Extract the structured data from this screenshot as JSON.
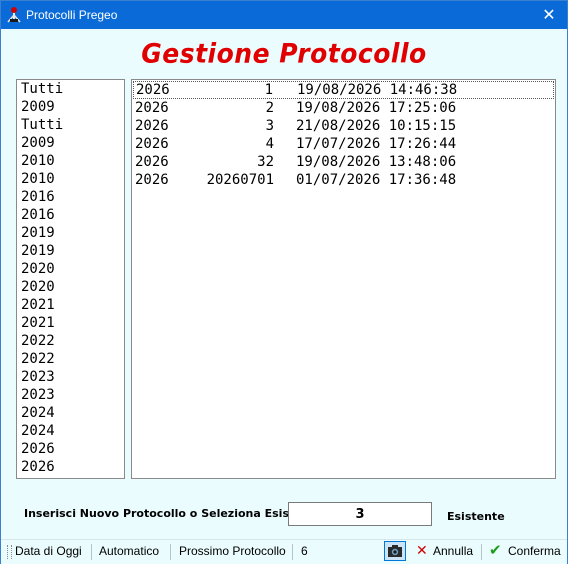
{
  "window": {
    "title": "Protocolli Pregeo",
    "close_glyph": "✕"
  },
  "heading": "Gestione Protocollo",
  "year_list": [
    "Tutti",
    "2009",
    "Tutti",
    "2009",
    "2010",
    "2010",
    "2016",
    "2016",
    "2019",
    "2019",
    "2020",
    "2020",
    "2021",
    "2021",
    "2022",
    "2022",
    "2023",
    "2023",
    "2024",
    "2024",
    "2026",
    "2026"
  ],
  "protocols": [
    {
      "year": "2026",
      "number": "1",
      "datetime": "19/08/2026 14:46:38"
    },
    {
      "year": "2026",
      "number": "2",
      "datetime": "19/08/2026 17:25:06"
    },
    {
      "year": "2026",
      "number": "3",
      "datetime": "21/08/2026 10:15:15"
    },
    {
      "year": "2026",
      "number": "4",
      "datetime": "17/07/2026 17:26:44"
    },
    {
      "year": "2026",
      "number": "32",
      "datetime": "19/08/2026 13:48:06"
    },
    {
      "year": "2026",
      "number": "20260701",
      "datetime": "01/07/2026 17:36:48"
    }
  ],
  "form": {
    "label": "Inserisci Nuovo Protocollo o Seleziona Esistente",
    "value": "3",
    "status": "Esistente"
  },
  "bottombar": {
    "data_di_oggi": "Data di Oggi",
    "automatico": "Automatico",
    "prossimo_label": "Prossimo Protocollo",
    "prossimo_value": "6",
    "annulla": "Annulla",
    "conferma": "Conferma"
  },
  "icons": {
    "app": "pregeo-app-icon",
    "camera": "camera-icon",
    "cancel": "cross-icon",
    "confirm": "checkmark-icon"
  },
  "colors": {
    "title_bar": "#0a6bd8",
    "heading": "#e00000",
    "background": "#ebfcfe",
    "cancel": "#d40000",
    "confirm": "#1a9e1a"
  }
}
